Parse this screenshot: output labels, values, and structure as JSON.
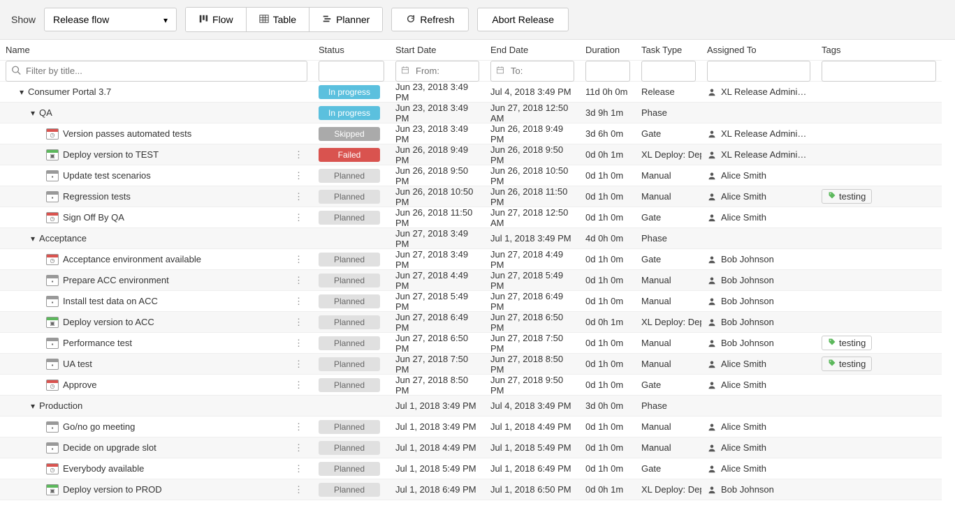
{
  "toolbar": {
    "show_label": "Show",
    "view_selected": "Release flow",
    "flow_label": "Flow",
    "table_label": "Table",
    "planner_label": "Planner",
    "refresh_label": "Refresh",
    "abort_label": "Abort Release"
  },
  "headers": {
    "name": "Name",
    "status": "Status",
    "start": "Start Date",
    "end": "End Date",
    "duration": "Duration",
    "tasktype": "Task Type",
    "assigned": "Assigned To",
    "tags": "Tags"
  },
  "filters": {
    "title_placeholder": "Filter by title...",
    "from_placeholder": "From:",
    "to_placeholder": "To:"
  },
  "status_labels": {
    "inprogress": "In progress",
    "skipped": "Skipped",
    "failed": "Failed",
    "planned": "Planned"
  },
  "rows": [
    {
      "indent": 0,
      "expand": "open",
      "name": "Consumer Portal 3.7",
      "status": "inprogress",
      "start": "Jun 23, 2018 3:49 PM",
      "end": "Jul 4, 2018 3:49 PM",
      "duration": "11d 0h 0m",
      "type": "Release",
      "user": "XL Release Administrator",
      "menu": false,
      "icon": null,
      "tags": []
    },
    {
      "indent": 1,
      "expand": "open",
      "name": "QA",
      "status": "inprogress",
      "start": "Jun 23, 2018 3:49 PM",
      "end": "Jun 27, 2018 12:50 AM",
      "duration": "3d 9h 1m",
      "type": "Phase",
      "user": "",
      "menu": false,
      "icon": null,
      "tags": []
    },
    {
      "indent": 2,
      "name": "Version passes automated tests",
      "status": "skipped",
      "start": "Jun 23, 2018 3:49 PM",
      "end": "Jun 26, 2018 9:49 PM",
      "duration": "3d 6h 0m",
      "type": "Gate",
      "user": "XL Release Administrator",
      "menu": false,
      "icon": "red",
      "iconGlyph": "◷",
      "tags": []
    },
    {
      "indent": 2,
      "name": "Deploy version to TEST",
      "status": "failed",
      "start": "Jun 26, 2018 9:49 PM",
      "end": "Jun 26, 2018 9:50 PM",
      "duration": "0d 0h 1m",
      "type": "XL Deploy: Dep...",
      "user": "XL Release Administrator",
      "menu": true,
      "icon": "green",
      "iconGlyph": "▣",
      "tags": []
    },
    {
      "indent": 2,
      "name": "Update test scenarios",
      "status": "planned",
      "start": "Jun 26, 2018 9:50 PM",
      "end": "Jun 26, 2018 10:50 PM",
      "duration": "0d 1h 0m",
      "type": "Manual",
      "user": "Alice Smith",
      "menu": true,
      "icon": "gray",
      "iconGlyph": "▪",
      "tags": []
    },
    {
      "indent": 2,
      "name": "Regression tests",
      "status": "planned",
      "start": "Jun 26, 2018 10:50 PM",
      "end": "Jun 26, 2018 11:50 PM",
      "duration": "0d 1h 0m",
      "type": "Manual",
      "user": "Alice Smith",
      "menu": true,
      "icon": "gray",
      "iconGlyph": "▪",
      "tags": [
        "testing"
      ]
    },
    {
      "indent": 2,
      "name": "Sign Off By QA",
      "status": "planned",
      "start": "Jun 26, 2018 11:50 PM",
      "end": "Jun 27, 2018 12:50 AM",
      "duration": "0d 1h 0m",
      "type": "Gate",
      "user": "Alice Smith",
      "menu": true,
      "icon": "red",
      "iconGlyph": "◷",
      "tags": []
    },
    {
      "indent": 1,
      "expand": "open",
      "name": "Acceptance",
      "status": "",
      "start": "Jun 27, 2018 3:49 PM",
      "end": "Jul 1, 2018 3:49 PM",
      "duration": "4d 0h 0m",
      "type": "Phase",
      "user": "",
      "menu": false,
      "icon": null,
      "tags": []
    },
    {
      "indent": 2,
      "name": "Acceptance environment available",
      "status": "planned",
      "start": "Jun 27, 2018 3:49 PM",
      "end": "Jun 27, 2018 4:49 PM",
      "duration": "0d 1h 0m",
      "type": "Gate",
      "user": "Bob Johnson",
      "menu": true,
      "icon": "red",
      "iconGlyph": "◷",
      "tags": []
    },
    {
      "indent": 2,
      "name": "Prepare ACC environment",
      "status": "planned",
      "start": "Jun 27, 2018 4:49 PM",
      "end": "Jun 27, 2018 5:49 PM",
      "duration": "0d 1h 0m",
      "type": "Manual",
      "user": "Bob Johnson",
      "menu": true,
      "icon": "gray",
      "iconGlyph": "▪",
      "tags": []
    },
    {
      "indent": 2,
      "name": "Install test data on ACC",
      "status": "planned",
      "start": "Jun 27, 2018 5:49 PM",
      "end": "Jun 27, 2018 6:49 PM",
      "duration": "0d 1h 0m",
      "type": "Manual",
      "user": "Bob Johnson",
      "menu": true,
      "icon": "gray",
      "iconGlyph": "▪",
      "tags": []
    },
    {
      "indent": 2,
      "name": "Deploy version to ACC",
      "status": "planned",
      "start": "Jun 27, 2018 6:49 PM",
      "end": "Jun 27, 2018 6:50 PM",
      "duration": "0d 0h 1m",
      "type": "XL Deploy: Dep...",
      "user": "Bob Johnson",
      "menu": true,
      "icon": "green",
      "iconGlyph": "▣",
      "tags": []
    },
    {
      "indent": 2,
      "name": "Performance test",
      "status": "planned",
      "start": "Jun 27, 2018 6:50 PM",
      "end": "Jun 27, 2018 7:50 PM",
      "duration": "0d 1h 0m",
      "type": "Manual",
      "user": "Bob Johnson",
      "menu": true,
      "icon": "gray",
      "iconGlyph": "▪",
      "tags": [
        "testing"
      ]
    },
    {
      "indent": 2,
      "name": "UA test",
      "status": "planned",
      "start": "Jun 27, 2018 7:50 PM",
      "end": "Jun 27, 2018 8:50 PM",
      "duration": "0d 1h 0m",
      "type": "Manual",
      "user": "Alice Smith",
      "menu": true,
      "icon": "gray",
      "iconGlyph": "▪",
      "tags": [
        "testing"
      ]
    },
    {
      "indent": 2,
      "name": "Approve",
      "status": "planned",
      "start": "Jun 27, 2018 8:50 PM",
      "end": "Jun 27, 2018 9:50 PM",
      "duration": "0d 1h 0m",
      "type": "Gate",
      "user": "Alice Smith",
      "menu": true,
      "icon": "red",
      "iconGlyph": "◷",
      "tags": []
    },
    {
      "indent": 1,
      "expand": "open",
      "name": "Production",
      "status": "",
      "start": "Jul 1, 2018 3:49 PM",
      "end": "Jul 4, 2018 3:49 PM",
      "duration": "3d 0h 0m",
      "type": "Phase",
      "user": "",
      "menu": false,
      "icon": null,
      "tags": []
    },
    {
      "indent": 2,
      "name": "Go/no go meeting",
      "status": "planned",
      "start": "Jul 1, 2018 3:49 PM",
      "end": "Jul 1, 2018 4:49 PM",
      "duration": "0d 1h 0m",
      "type": "Manual",
      "user": "Alice Smith",
      "menu": true,
      "icon": "gray",
      "iconGlyph": "▪",
      "tags": []
    },
    {
      "indent": 2,
      "name": "Decide on upgrade slot",
      "status": "planned",
      "start": "Jul 1, 2018 4:49 PM",
      "end": "Jul 1, 2018 5:49 PM",
      "duration": "0d 1h 0m",
      "type": "Manual",
      "user": "Alice Smith",
      "menu": true,
      "icon": "gray",
      "iconGlyph": "▪",
      "tags": []
    },
    {
      "indent": 2,
      "name": "Everybody available",
      "status": "planned",
      "start": "Jul 1, 2018 5:49 PM",
      "end": "Jul 1, 2018 6:49 PM",
      "duration": "0d 1h 0m",
      "type": "Gate",
      "user": "Alice Smith",
      "menu": true,
      "icon": "red",
      "iconGlyph": "◷",
      "tags": []
    },
    {
      "indent": 2,
      "name": "Deploy version to PROD",
      "status": "planned",
      "start": "Jul 1, 2018 6:49 PM",
      "end": "Jul 1, 2018 6:50 PM",
      "duration": "0d 0h 1m",
      "type": "XL Deploy: Dep...",
      "user": "Bob Johnson",
      "menu": true,
      "icon": "green",
      "iconGlyph": "▣",
      "tags": []
    }
  ]
}
